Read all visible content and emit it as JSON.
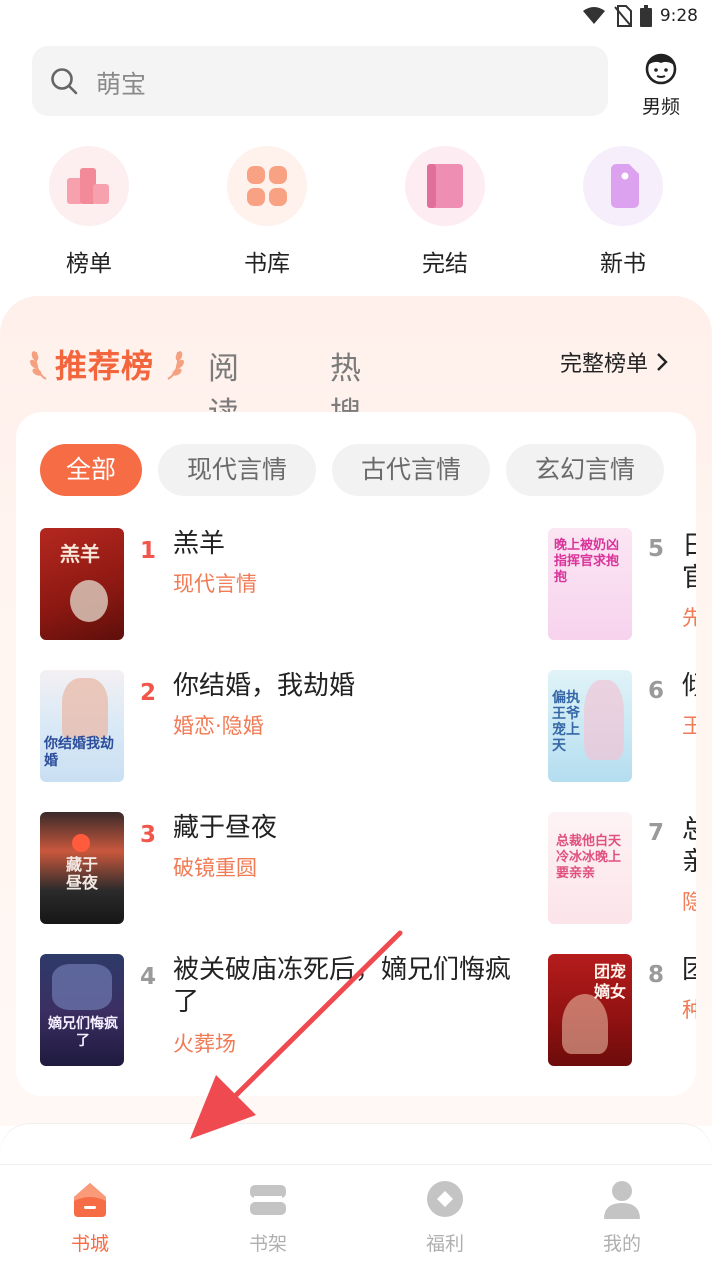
{
  "status_bar": {
    "time": "9:28"
  },
  "search": {
    "placeholder": "萌宝"
  },
  "gender_switch": {
    "label": "男频"
  },
  "categories": [
    {
      "label": "榜单",
      "icon": "ranking-icon"
    },
    {
      "label": "书库",
      "icon": "library-grid-icon"
    },
    {
      "label": "完结",
      "icon": "book-icon"
    },
    {
      "label": "新书",
      "icon": "new-tag-icon"
    }
  ],
  "ranking": {
    "tabs": [
      "推荐榜",
      "阅读榜",
      "热搜榜"
    ],
    "active_tab": "推荐榜",
    "full_list_label": "完整榜单",
    "filters": [
      "全部",
      "现代言情",
      "古代言情",
      "玄幻言情"
    ],
    "active_filter": "全部",
    "books_left": [
      {
        "rank": "1",
        "title": "羔羊",
        "tag": "现代言情",
        "cover_text": "羔羊"
      },
      {
        "rank": "2",
        "title": "你结婚，我劫婚",
        "tag": "婚恋·隐婚",
        "cover_text": "你结婚我劫婚"
      },
      {
        "rank": "3",
        "title": "藏于昼夜",
        "tag": "破镜重圆",
        "cover_text": "藏于昼夜"
      },
      {
        "rank": "4",
        "title": "被关破庙冻死后，嫡兄们悔疯了",
        "tag": "火葬场",
        "cover_text": "嫡兄们悔疯了"
      }
    ],
    "books_right": [
      {
        "rank": "5",
        "title_partial": "日",
        "title_partial2": "官",
        "tag_partial": "先",
        "cover_text": "晚上被奶凶指挥官求抱抱"
      },
      {
        "rank": "6",
        "title_partial": "倾",
        "tag_partial": "王",
        "cover_text": "偏执王爷宠上天"
      },
      {
        "rank": "7",
        "title_partial": "总",
        "title_partial2": "亲",
        "tag_partial": "隐",
        "cover_text": "总裁他白天冷冰冰晚上要亲亲"
      },
      {
        "rank": "8",
        "title_partial": "团",
        "tag_partial": "种",
        "cover_text": "团宠嫡女"
      }
    ]
  },
  "bottom_nav": [
    {
      "label": "书城",
      "active": true
    },
    {
      "label": "书架",
      "active": false
    },
    {
      "label": "福利",
      "active": false
    },
    {
      "label": "我的",
      "active": false
    }
  ],
  "colors": {
    "accent": "#f56c45",
    "rank_top": "#f0564a",
    "rank_other": "#9a9a9a",
    "tag": "#f07b55"
  }
}
